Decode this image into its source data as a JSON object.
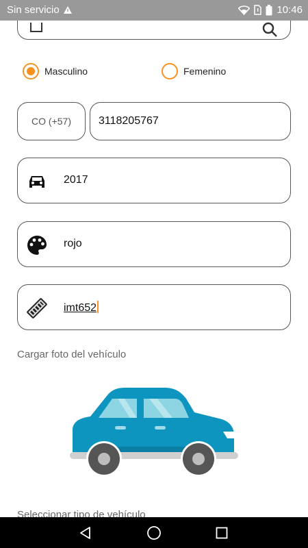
{
  "status_bar": {
    "carrier": "Sin servicio",
    "time": "10:46",
    "icons": [
      "no-sim-icon",
      "wifi-icon",
      "battery-icon"
    ]
  },
  "gender": {
    "option_male": "Masculino",
    "option_female": "Femenino",
    "selected": "Masculino",
    "accent_color": "#f7921e"
  },
  "phone": {
    "country_code": "CO (+57)",
    "number": "3118205767"
  },
  "vehicle": {
    "year": "2017",
    "color": "rojo",
    "plate": "imt652",
    "year_icon": "car-icon",
    "color_icon": "palette-icon",
    "plate_icon": "license-plate-icon"
  },
  "upload": {
    "label": "Cargar foto del vehículo",
    "image_icon": "car-placeholder-icon"
  },
  "next_section": {
    "label": "Seleccionar tipo de vehículo"
  },
  "nav": {
    "icons": [
      "back-icon",
      "home-icon",
      "recents-icon"
    ]
  }
}
